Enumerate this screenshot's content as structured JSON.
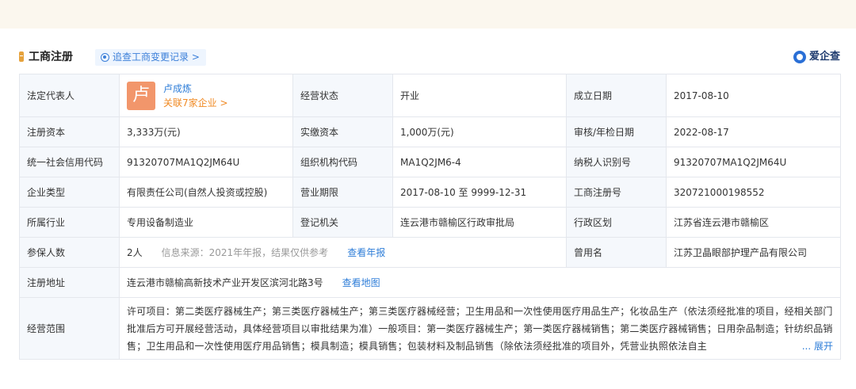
{
  "header": {
    "title": "工商注册",
    "trace_label": "追查工商变更记录 >",
    "brand": "爱企查"
  },
  "rows": {
    "legal_rep": {
      "label": "法定代表人",
      "avatar_char": "卢",
      "name": "卢成炼",
      "related": "关联7家企业 >"
    },
    "status": {
      "label": "经营状态",
      "value": "开业"
    },
    "founded": {
      "label": "成立日期",
      "value": "2017-08-10"
    },
    "reg_capital": {
      "label": "注册资本",
      "value": "3,333万(元)"
    },
    "paid_capital": {
      "label": "实缴资本",
      "value": "1,000万(元)"
    },
    "approval_date": {
      "label": "审核/年检日期",
      "value": "2022-08-17"
    },
    "credit_code": {
      "label": "统一社会信用代码",
      "value": "91320707MA1Q2JM64U"
    },
    "org_code": {
      "label": "组织机构代码",
      "value": "MA1Q2JM6-4"
    },
    "taxpayer_id": {
      "label": "纳税人识别号",
      "value": "91320707MA1Q2JM64U"
    },
    "company_type": {
      "label": "企业类型",
      "value": "有限责任公司(自然人投资或控股)"
    },
    "term": {
      "label": "营业期限",
      "value": "2017-08-10 至 9999-12-31"
    },
    "reg_no": {
      "label": "工商注册号",
      "value": "320721000198552"
    },
    "industry": {
      "label": "所属行业",
      "value": "专用设备制造业"
    },
    "authority": {
      "label": "登记机关",
      "value": "连云港市赣榆区行政审批局"
    },
    "region": {
      "label": "行政区划",
      "value": "江苏省连云港市赣榆区"
    },
    "insured": {
      "label": "参保人数",
      "value": "2人",
      "source": "信息来源：2021年年报，结果仅供参考",
      "link": "查看年报"
    },
    "former_name": {
      "label": "曾用名",
      "value": "江苏卫晶眼部护理产品有限公司"
    },
    "address": {
      "label": "注册地址",
      "value": "连云港市赣榆高新技术产业开发区滨河北路3号",
      "link": "查看地图"
    },
    "scope": {
      "label": "经营范围",
      "value": "许可项目：第二类医疗器械生产；第三类医疗器械生产；第三类医疗器械经营；卫生用品和一次性使用医疗用品生产；化妆品生产（依法须经批准的项目，经相关部门批准后方可开展经营活动，具体经营项目以审批结果为准）一般项目：第一类医疗器械生产；第一类医疗器械销售；第二类医疗器械销售；日用杂品制造；针纺织品销售；卫生用品和一次性使用医疗用品销售；模具制造；模具销售；包装材料及制品销售（除依法须经批准的项目外，凭营业执照依法自主",
      "expand": "... 展开"
    }
  }
}
